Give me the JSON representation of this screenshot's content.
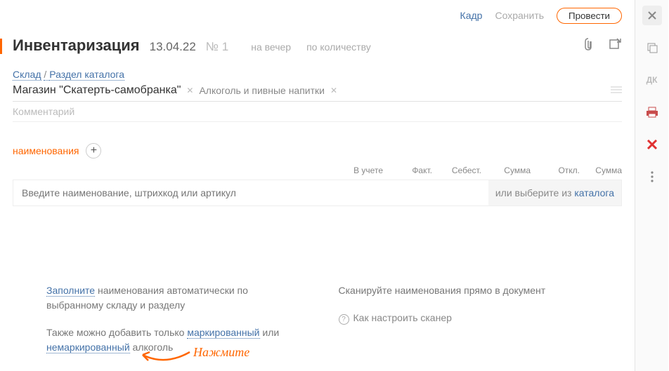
{
  "topbar": {
    "frame": "Кадр",
    "save": "Сохранить",
    "process": "Провести"
  },
  "header": {
    "title": "Инвентаризация",
    "date": "13.04.22",
    "num": "№ 1",
    "opt1": "на вечер",
    "opt2": "по количеству"
  },
  "breadcrumb": {
    "warehouse": "Склад",
    "section": "Раздел каталога"
  },
  "store": {
    "name": "Магазин \"Скатерть-самобранка\"",
    "category": "Алкоголь и пивные напитки"
  },
  "comment_placeholder": "Комментарий",
  "tabs": {
    "names": "наименования"
  },
  "columns": {
    "in_stock": "В учете",
    "fact": "Факт.",
    "cost": "Себест.",
    "sum": "Сумма",
    "dev": "Откл.",
    "sum2": "Сумма"
  },
  "input": {
    "placeholder": "Введите наименование, штрихкод или артикул",
    "or": "или выберите из ",
    "catalog": "каталога"
  },
  "hints": {
    "fill": "Заполните",
    "fill_rest": " наименования автоматически по выбранному складу и разделу",
    "also": "Также можно добавить только ",
    "marked": "маркированный",
    "or": " или ",
    "unmarked": "немаркированный",
    "alcohol": " алкоголь",
    "scan": "Сканируйте наименования прямо в документ",
    "howto": "Как настроить сканер"
  },
  "annotation": "Нажмите",
  "sidetext": {
    "dk": "ДК"
  }
}
